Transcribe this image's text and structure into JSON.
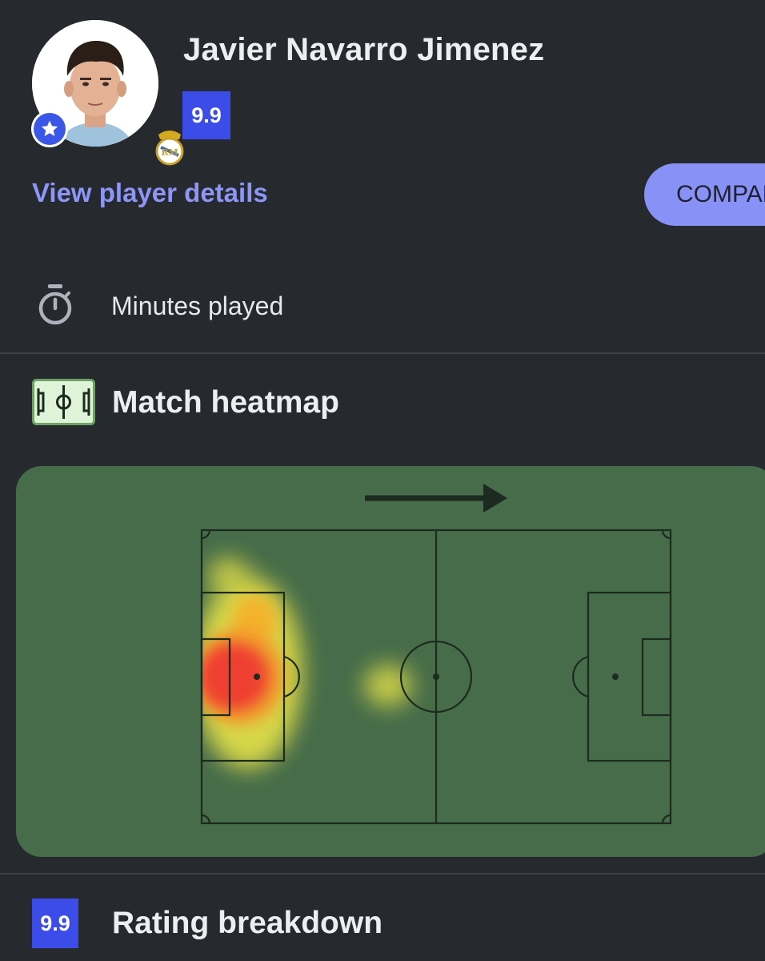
{
  "player": {
    "name": "Javier Navarro Jimenez",
    "rating": "9.9",
    "avatar_icon": "player-photo",
    "badge_icon": "star-icon",
    "club_icon": "real-madrid-crest"
  },
  "actions": {
    "details_link": "View player details",
    "compare_button": "COMPARE"
  },
  "stats": {
    "minutes_label": "Minutes played",
    "minutes_icon": "stopwatch-icon"
  },
  "heatmap": {
    "title": "Match heatmap",
    "icon": "pitch-icon",
    "attack_direction": "right",
    "hot_zones": [
      {
        "zone": "own-penalty-area-centre",
        "intensity": "high"
      },
      {
        "zone": "own-penalty-area-upper",
        "intensity": "medium"
      },
      {
        "zone": "own-left-wing-deep",
        "intensity": "low"
      },
      {
        "zone": "midfield-left-of-centre-circle",
        "intensity": "low"
      }
    ],
    "colors": {
      "pitch": "#466c49",
      "lines": "#1d2a1f",
      "hot": "#ef3b33",
      "warm": "#f5b12b",
      "cool": "#e6e34a"
    }
  },
  "rating_breakdown": {
    "rating": "9.9",
    "title": "Rating breakdown"
  },
  "colors": {
    "background": "#26292e",
    "accent": "#8791f6",
    "rating_blue": "#3b4ce8"
  }
}
